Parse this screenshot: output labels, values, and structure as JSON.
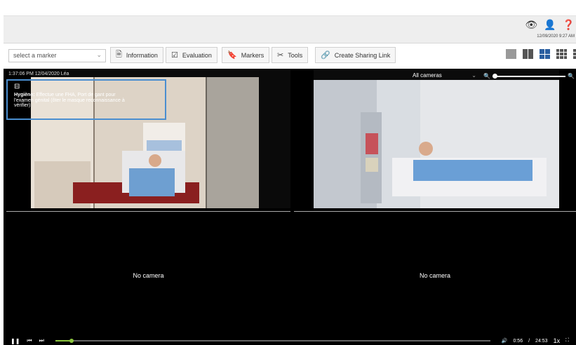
{
  "header": {
    "icons": [
      "eye-icon",
      "user-icon",
      "help-icon"
    ],
    "datetime": "12/09/2020 9:27 AM"
  },
  "toolbar": {
    "marker_select": {
      "value": "select a marker",
      "placeholder": "select a marker"
    },
    "buttons": [
      {
        "label": "Information",
        "icon": "document-icon"
      },
      {
        "label": "Evaluation",
        "icon": "checkbox-icon"
      },
      {
        "label": "Markers",
        "icon": "bookmark-icon"
      },
      {
        "label": "Tools",
        "icon": "scissors-icon"
      },
      {
        "label": "Create Sharing Link",
        "icon": "link-icon"
      }
    ],
    "layouts": [
      "single",
      "two-column",
      "quad",
      "nine-grid",
      "vertical"
    ],
    "active_layout": "quad"
  },
  "video": {
    "header_text": "1:37:06 PM 12/04/2020 Léa",
    "marker": {
      "title": "Hygiène:",
      "text": " Effectue une FHA, Port de gant pour l'examen génital (ôter le masque reconnaissance à vérifier)"
    },
    "camera_select": "All cameras",
    "no_camera_label": "No camera"
  },
  "playback": {
    "current_time": "0:56",
    "separator": "/",
    "total_time": "24:53",
    "speed": "1x",
    "progress_fraction": 0.038
  },
  "colors": {
    "accent": "#4a8ed0",
    "progress_handle": "#8cc63f"
  }
}
